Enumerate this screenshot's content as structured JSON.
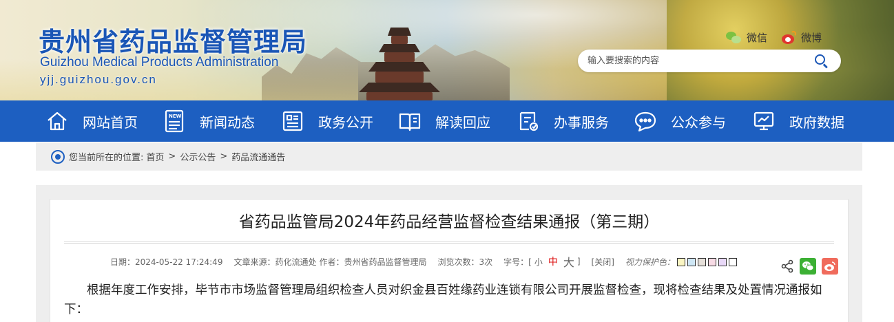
{
  "header": {
    "title_cn": "贵州省药品监督管理局",
    "title_en": "Guizhou Medical Products Administration",
    "url": "yjj.guizhou.gov.cn",
    "wechat_label": "微信",
    "weibo_label": "微博",
    "search_placeholder": "输入要搜索的内容"
  },
  "nav": {
    "items": [
      {
        "label": "网站首页",
        "icon": "home-icon"
      },
      {
        "label": "新闻动态",
        "icon": "news-icon"
      },
      {
        "label": "政务公开",
        "icon": "document-icon"
      },
      {
        "label": "解读回应",
        "icon": "book-icon"
      },
      {
        "label": "办事服务",
        "icon": "service-icon"
      },
      {
        "label": "公众参与",
        "icon": "chat-icon"
      },
      {
        "label": "政府数据",
        "icon": "data-icon"
      }
    ]
  },
  "breadcrumb": {
    "prefix": "您当前所在的位置:",
    "items": [
      "首页",
      "公示公告",
      "药品流通通告"
    ],
    "separator": ">"
  },
  "article": {
    "title": "省药品监管局2024年药品经营监督检查结果通报（第三期）",
    "date": "日期：2024-05-22 17:24:49",
    "source": "文章来源：药化流通处",
    "author": "作者：贵州省药品监督管理局",
    "views": "浏览次数：3次",
    "font_label": "字号：[",
    "font_small": "小",
    "font_mid": "中",
    "font_big": "大",
    "font_end": "]",
    "close": "[关闭]",
    "eye_label": "视力保护色：",
    "swatch_colors": [
      "#fbf6c3",
      "#cfe7f5",
      "#e6e0da",
      "#f7dbe5",
      "#e8d8f7",
      "#ffffff"
    ],
    "body": "根据年度工作安排，毕节市市场监督管理局组织检查人员对织金县百姓缘药业连锁有限公司开展监督检查，现将检查结果及处置情况通报如下："
  },
  "colors": {
    "nav_bg": "#1d5fc1",
    "brand_blue": "#1a56b6",
    "crumb_bg": "#eeeeee"
  }
}
